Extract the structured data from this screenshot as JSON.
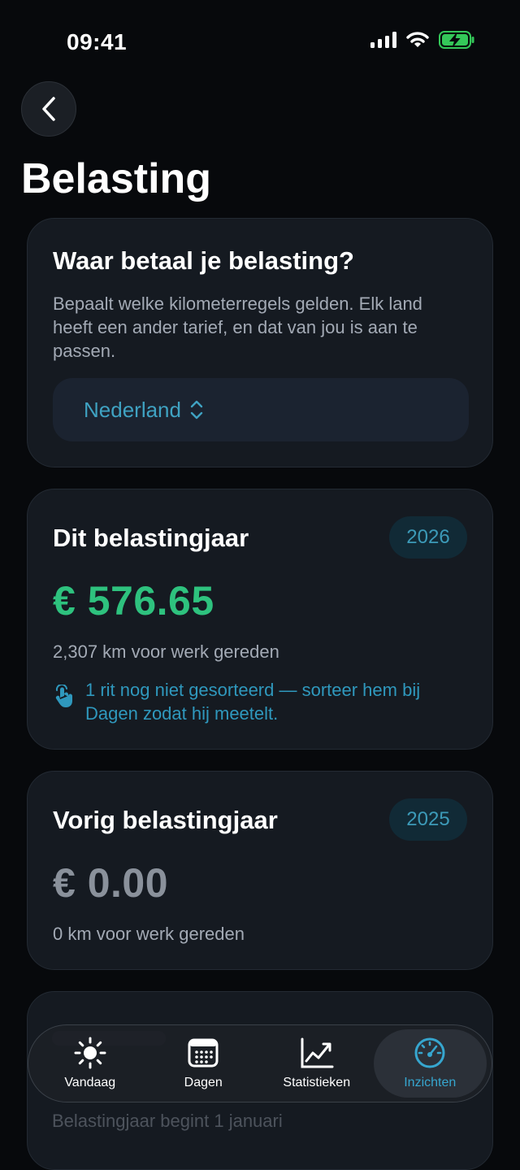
{
  "status_bar": {
    "time": "09:41"
  },
  "header": {
    "title": "Belasting"
  },
  "tax_country": {
    "title": "Waar betaal je belasting?",
    "description": "Bepaalt welke kilometerregels gelden. Elk land heeft een ander tarief, en dat van jou is aan te passen.",
    "selected_country": "Nederland"
  },
  "current_year": {
    "title": "Dit belastingjaar",
    "year": "2026",
    "amount": "€ 576.65",
    "km_text": "2,307 km voor werk gereden",
    "notice": "1 rit nog niet gesorteerd — sorteer hem bij Dagen zodat hij meetelt.",
    "amount_color": "#2ec27e"
  },
  "previous_year": {
    "title": "Vorig belastingjaar",
    "year": "2025",
    "amount": "€ 0.00",
    "km_text": "0 km voor werk gereden",
    "amount_color": "#8a919b"
  },
  "peek_card": {
    "text": "Belastingjaar begint 1 januari"
  },
  "tab_bar": {
    "tabs": [
      {
        "label": "Vandaag",
        "icon": "sun-icon"
      },
      {
        "label": "Dagen",
        "icon": "calendar-icon"
      },
      {
        "label": "Statistieken",
        "icon": "chart-line-icon"
      },
      {
        "label": "Inzichten",
        "icon": "gauge-icon",
        "active": true
      }
    ]
  },
  "colors": {
    "accent": "#36a6cf",
    "positive": "#2ec27e",
    "background": "#07090c",
    "card": "#151a21"
  }
}
